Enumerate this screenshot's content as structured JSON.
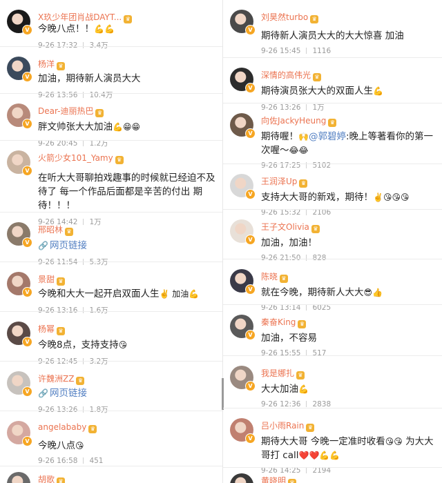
{
  "left_column": [
    {
      "name": "X玖少年团肖战DAYT...",
      "text": "今晚八点！！",
      "emoji": "💪💪",
      "date": "9-26 17:32",
      "likes": "3.4万",
      "avatar_color": "#1a1a1a"
    },
    {
      "name": "杨洋",
      "text": "加油，期待新人演员大大",
      "emoji": "",
      "date": "9-26 13:56",
      "likes": "10.4万",
      "avatar_color": "#3b4a5c"
    },
    {
      "name": "Dear-迪丽热巴",
      "text": "胖文帅张大大加油",
      "emoji": "💪😁😁",
      "date": "9-26 20:45",
      "likes": "1.2万",
      "avatar_color": "#b88a7a"
    },
    {
      "name": "火箭少女101_Yamy",
      "text": "在听大大哥聊拍戏趣事的时候就已经迫不及待了 每一个作品后面都是辛苦的付出 期待！！！",
      "emoji": "",
      "date": "9-26 14:42",
      "likes": "1万",
      "avatar_color": "#c9b3a0"
    },
    {
      "name": "邢昭林",
      "link_icon": "🔗",
      "link": "网页链接",
      "date": "9-26 11:54",
      "likes": "5.3万",
      "avatar_color": "#8a7a6a"
    },
    {
      "name": "景甜",
      "text": "今晚和大大一起开启双面人生",
      "emoji": "✌️ 加油💪",
      "date": "9-26 13:16",
      "likes": "1.6万",
      "avatar_color": "#a4786a"
    },
    {
      "name": "杨幂",
      "text": "今晚8点，支持支持",
      "emoji": "😘",
      "date": "9-26 12:45",
      "likes": "3.2万",
      "avatar_color": "#5a4a46"
    },
    {
      "name": "许魏洲ZZ",
      "link_icon": "🔗",
      "link": "网页链接",
      "date": "9-26 13:26",
      "likes": "1.8万",
      "avatar_color": "#c7c2bd"
    },
    {
      "name": "angelababy",
      "text": "今晚八点",
      "emoji": "😘",
      "date": "9-26 16:58",
      "likes": "451",
      "avatar_color": "#d4a8a0"
    },
    {
      "name": "胡歌",
      "avatar_color": "#6a6a6a"
    }
  ],
  "right_column": [
    {
      "name": "刘昊然turbo",
      "text": "期待新人演员大大的大大惊喜 加油",
      "emoji": "",
      "date": "9-26 15:45",
      "likes": "1116",
      "avatar_color": "#4a4a4a"
    },
    {
      "name": "深情的高伟光",
      "text": "期待演员张大大的双面人生",
      "emoji": "💪",
      "date": "9-26 13:26",
      "likes": "1万",
      "avatar_color": "#2c2c2c"
    },
    {
      "name": "向佐JackyHeung",
      "text_before": "期待喔！",
      "emoji_mid": "🙌",
      "mention": "@郭碧婷",
      "text_after": ":晚上等著看你的第一次喔～",
      "emoji": "😂😂",
      "date": "9-26 17:25",
      "likes": "5102",
      "avatar_color": "#6e5a4a"
    },
    {
      "name": "王润泽Up",
      "text": "支持大大哥的新戏，期待！",
      "emoji": "✌️😘😘😘",
      "date": "9-26 15:32",
      "likes": "2106",
      "avatar_color": "#d8d8d8"
    },
    {
      "name": "王子文Olivia",
      "text": "加油，加油！",
      "emoji": "",
      "date": "9-26 21:50",
      "likes": "828",
      "avatar_color": "#e8e0d8"
    },
    {
      "name": "陈晓",
      "text": "就在今晚，期待新人大大",
      "emoji": "😎👍",
      "date": "9-26 13:14",
      "likes": "6025",
      "avatar_color": "#3a3a48"
    },
    {
      "name": "秦奋King",
      "text": "加油，不容易",
      "emoji": "",
      "date": "9-26 15:55",
      "likes": "517",
      "avatar_color": "#5a5a5a"
    },
    {
      "name": "我是娜扎",
      "text": "大大加油",
      "emoji": "💪",
      "date": "9-26 12:36",
      "likes": "2838",
      "avatar_color": "#9a8a80"
    },
    {
      "name": "吕小雨Rain",
      "text": "期待大大哥 今晚一定准时收看",
      "emoji": "😘😘",
      "text2": " 为大大哥打 call",
      "emoji2": "❤️❤️💪💪",
      "date": "9-26 14:25",
      "likes": "2194",
      "avatar_color": "#c08070"
    },
    {
      "name": "黄晓明",
      "avatar_color": "#3a3a3a"
    }
  ],
  "icons": {
    "verified": "v-badge",
    "crown": "crown-badge"
  }
}
